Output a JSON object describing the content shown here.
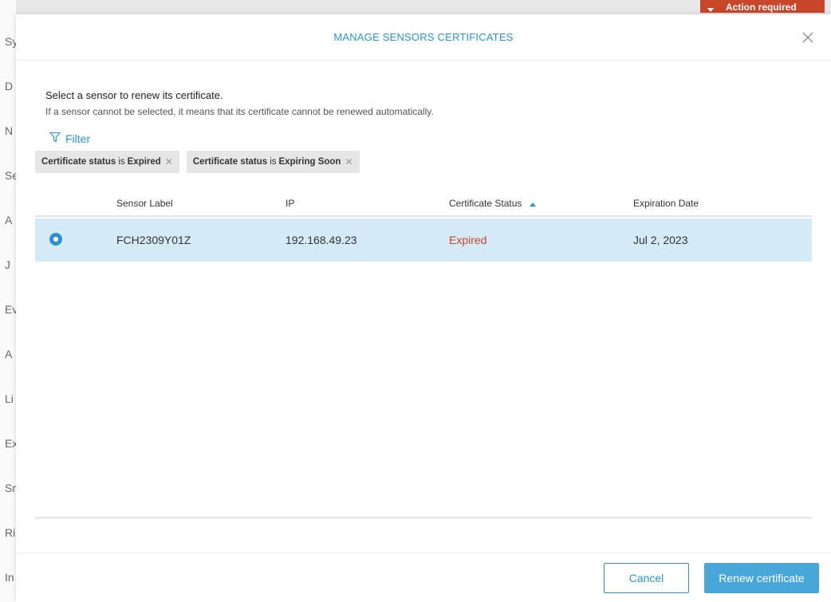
{
  "background": {
    "action_required": "Action required",
    "sidebar_letters": [
      "Sy",
      "D",
      "N",
      "Se",
      "A",
      "J",
      "Ev",
      "A",
      "Li",
      "Ex",
      "Sr",
      "Ri",
      "In"
    ]
  },
  "modal": {
    "title": "MANAGE SENSORS CERTIFICATES",
    "intro_title": "Select a sensor to renew its certificate.",
    "intro_desc": "If a sensor cannot be selected, it means that its certificate cannot be renewed automatically.",
    "filter_label": "Filter",
    "chips": [
      {
        "field": "Certificate status",
        "op": "is",
        "value": "Expired"
      },
      {
        "field": "Certificate status",
        "op": "is",
        "value": "Expiring Soon"
      }
    ],
    "columns": {
      "sensor_label": "Sensor Label",
      "ip": "IP",
      "certificate_status": "Certificate Status",
      "expiration_date": "Expiration Date"
    },
    "rows": [
      {
        "sensor_label": "FCH2309Y01Z",
        "ip": "192.168.49.23",
        "status": "Expired",
        "expiration_date": "Jul 2, 2023",
        "selected": true
      }
    ],
    "buttons": {
      "cancel": "Cancel",
      "renew": "Renew certificate"
    }
  },
  "colors": {
    "accent": "#2f93c9",
    "selected_row": "#d4eaf6",
    "expired": "#c8462a",
    "primary_button": "#49a6d9"
  }
}
